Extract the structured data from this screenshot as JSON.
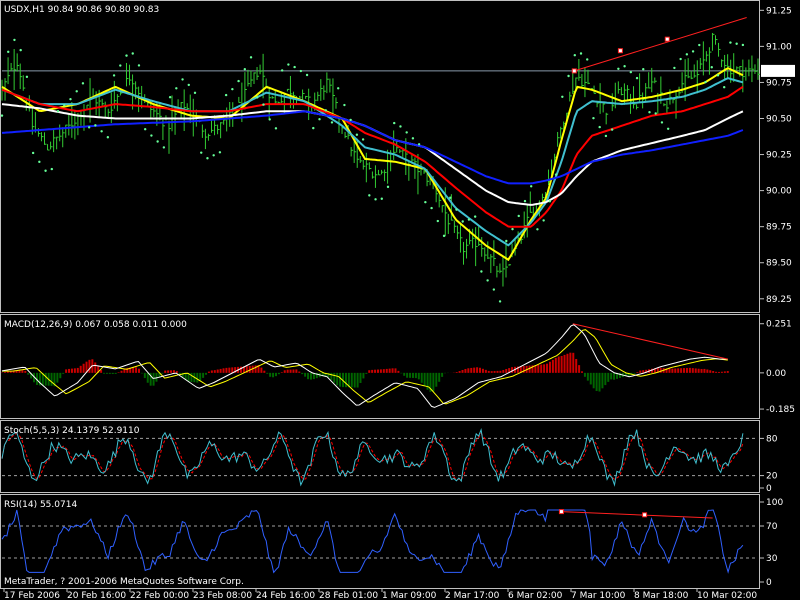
{
  "colors": {
    "background": "#000000",
    "frame": "#c0c0c0",
    "bars": "#33cc33",
    "psar": "#66ff99",
    "ma_yellow": "#ffff00",
    "ma_cyan": "#40c0d0",
    "ma_red": "#ff0000",
    "ma_white": "#ffffff",
    "ma_blue": "#1020ff",
    "trendline": "#ff2020",
    "macd_up": "#cc0000",
    "macd_down": "#006600",
    "macd_line": "#ffffff",
    "signal_line": "#ffff00",
    "stoch_main": "#40c0d0",
    "stoch_signal": "#ff0000",
    "rsi_line": "#3060ff",
    "level": "#a0a0a0"
  },
  "chart_data": [
    {
      "type": "candlestick",
      "title": "USDX,H1",
      "ohlc_text": "90.84 90.86 90.80 90.83",
      "current_price": "90.83",
      "ylim": [
        89.2,
        91.28
      ],
      "y_ticks": [
        "91.25",
        "91.00",
        "90.75",
        "90.50",
        "90.25",
        "90.00",
        "89.75",
        "89.50",
        "89.25"
      ],
      "y_tick_values": [
        91.25,
        91.0,
        90.75,
        90.5,
        90.25,
        90.0,
        89.75,
        89.5,
        89.25
      ],
      "x_labels": [
        "17 Feb 2006",
        "20 Feb 16:00",
        "22 Feb 00:00",
        "23 Feb 08:00",
        "24 Feb 16:00",
        "28 Feb 01:00",
        "1 Mar 09:00",
        "2 Mar 17:00",
        "6 Mar 02:00",
        "7 Mar 10:00",
        "8 Mar 18:00",
        "10 Mar 02:00"
      ],
      "price_path": [
        [
          0,
          90.7
        ],
        [
          0.02,
          90.9
        ],
        [
          0.04,
          90.45
        ],
        [
          0.06,
          90.3
        ],
        [
          0.09,
          90.45
        ],
        [
          0.12,
          90.65
        ],
        [
          0.14,
          90.55
        ],
        [
          0.17,
          90.8
        ],
        [
          0.19,
          90.6
        ],
        [
          0.22,
          90.45
        ],
        [
          0.24,
          90.6
        ],
        [
          0.27,
          90.4
        ],
        [
          0.29,
          90.45
        ],
        [
          0.31,
          90.55
        ],
        [
          0.34,
          90.85
        ],
        [
          0.36,
          90.6
        ],
        [
          0.38,
          90.7
        ],
        [
          0.41,
          90.6
        ],
        [
          0.43,
          90.75
        ],
        [
          0.45,
          90.45
        ],
        [
          0.47,
          90.2
        ],
        [
          0.5,
          90.1
        ],
        [
          0.52,
          90.3
        ],
        [
          0.55,
          90.15
        ],
        [
          0.57,
          90.05
        ],
        [
          0.59,
          89.8
        ],
        [
          0.61,
          89.6
        ],
        [
          0.63,
          89.65
        ],
        [
          0.65,
          89.5
        ],
        [
          0.66,
          89.4
        ],
        [
          0.68,
          89.6
        ],
        [
          0.7,
          89.85
        ],
        [
          0.72,
          90.0
        ],
        [
          0.74,
          90.45
        ],
        [
          0.76,
          90.8
        ],
        [
          0.78,
          90.7
        ],
        [
          0.8,
          90.55
        ],
        [
          0.82,
          90.7
        ],
        [
          0.84,
          90.6
        ],
        [
          0.86,
          90.75
        ],
        [
          0.88,
          90.6
        ],
        [
          0.9,
          90.75
        ],
        [
          0.92,
          90.8
        ],
        [
          0.94,
          91.05
        ],
        [
          0.96,
          90.85
        ],
        [
          0.98,
          90.83
        ]
      ],
      "series": [
        {
          "name": "",
          "style": "ma_yellow",
          "points": [
            [
              0,
              90.72
            ],
            [
              0.05,
              90.55
            ],
            [
              0.1,
              90.6
            ],
            [
              0.15,
              90.72
            ],
            [
              0.2,
              90.6
            ],
            [
              0.25,
              90.52
            ],
            [
              0.3,
              90.5
            ],
            [
              0.35,
              90.72
            ],
            [
              0.4,
              90.62
            ],
            [
              0.45,
              90.5
            ],
            [
              0.48,
              90.22
            ],
            [
              0.52,
              90.2
            ],
            [
              0.56,
              90.15
            ],
            [
              0.6,
              89.8
            ],
            [
              0.64,
              89.62
            ],
            [
              0.67,
              89.52
            ],
            [
              0.7,
              89.8
            ],
            [
              0.72,
              89.95
            ],
            [
              0.74,
              90.35
            ],
            [
              0.76,
              90.72
            ],
            [
              0.78,
              90.7
            ],
            [
              0.82,
              90.62
            ],
            [
              0.86,
              90.65
            ],
            [
              0.9,
              90.7
            ],
            [
              0.93,
              90.75
            ],
            [
              0.96,
              90.85
            ],
            [
              0.98,
              90.8
            ]
          ]
        },
        {
          "name": "",
          "style": "ma_cyan",
          "points": [
            [
              0,
              90.7
            ],
            [
              0.05,
              90.6
            ],
            [
              0.1,
              90.6
            ],
            [
              0.15,
              90.7
            ],
            [
              0.2,
              90.62
            ],
            [
              0.25,
              90.55
            ],
            [
              0.3,
              90.55
            ],
            [
              0.35,
              90.68
            ],
            [
              0.4,
              90.62
            ],
            [
              0.45,
              90.45
            ],
            [
              0.48,
              90.3
            ],
            [
              0.52,
              90.25
            ],
            [
              0.56,
              90.15
            ],
            [
              0.6,
              89.88
            ],
            [
              0.64,
              89.72
            ],
            [
              0.67,
              89.62
            ],
            [
              0.7,
              89.78
            ],
            [
              0.72,
              89.92
            ],
            [
              0.74,
              90.2
            ],
            [
              0.76,
              90.55
            ],
            [
              0.78,
              90.62
            ],
            [
              0.82,
              90.6
            ],
            [
              0.86,
              90.62
            ],
            [
              0.9,
              90.65
            ],
            [
              0.93,
              90.7
            ],
            [
              0.96,
              90.78
            ],
            [
              0.98,
              90.75
            ]
          ]
        },
        {
          "name": "",
          "style": "ma_red",
          "points": [
            [
              0,
              90.7
            ],
            [
              0.05,
              90.6
            ],
            [
              0.1,
              90.55
            ],
            [
              0.15,
              90.6
            ],
            [
              0.2,
              90.58
            ],
            [
              0.25,
              90.55
            ],
            [
              0.3,
              90.55
            ],
            [
              0.35,
              90.6
            ],
            [
              0.4,
              90.6
            ],
            [
              0.45,
              90.5
            ],
            [
              0.48,
              90.4
            ],
            [
              0.52,
              90.32
            ],
            [
              0.56,
              90.2
            ],
            [
              0.6,
              90.02
            ],
            [
              0.64,
              89.85
            ],
            [
              0.67,
              89.75
            ],
            [
              0.7,
              89.75
            ],
            [
              0.72,
              89.85
            ],
            [
              0.74,
              90.0
            ],
            [
              0.76,
              90.25
            ],
            [
              0.78,
              90.38
            ],
            [
              0.82,
              90.45
            ],
            [
              0.86,
              90.52
            ],
            [
              0.9,
              90.55
            ],
            [
              0.93,
              90.6
            ],
            [
              0.96,
              90.65
            ],
            [
              0.98,
              90.72
            ]
          ]
        },
        {
          "name": "",
          "style": "ma_white",
          "points": [
            [
              0,
              90.6
            ],
            [
              0.05,
              90.57
            ],
            [
              0.1,
              90.52
            ],
            [
              0.15,
              90.5
            ],
            [
              0.2,
              90.5
            ],
            [
              0.25,
              90.5
            ],
            [
              0.3,
              90.52
            ],
            [
              0.35,
              90.55
            ],
            [
              0.4,
              90.55
            ],
            [
              0.45,
              90.5
            ],
            [
              0.48,
              90.45
            ],
            [
              0.52,
              90.35
            ],
            [
              0.56,
              90.3
            ],
            [
              0.6,
              90.15
            ],
            [
              0.64,
              90.0
            ],
            [
              0.67,
              89.92
            ],
            [
              0.7,
              89.9
            ],
            [
              0.72,
              89.92
            ],
            [
              0.74,
              89.98
            ],
            [
              0.76,
              90.1
            ],
            [
              0.78,
              90.2
            ],
            [
              0.82,
              90.28
            ],
            [
              0.86,
              90.33
            ],
            [
              0.9,
              90.38
            ],
            [
              0.93,
              90.42
            ],
            [
              0.96,
              90.5
            ],
            [
              0.98,
              90.55
            ]
          ]
        },
        {
          "name": "",
          "style": "ma_blue",
          "points": [
            [
              0,
              90.4
            ],
            [
              0.05,
              90.42
            ],
            [
              0.1,
              90.44
            ],
            [
              0.15,
              90.46
            ],
            [
              0.2,
              90.47
            ],
            [
              0.25,
              90.48
            ],
            [
              0.3,
              90.5
            ],
            [
              0.35,
              90.52
            ],
            [
              0.4,
              90.55
            ],
            [
              0.45,
              90.5
            ],
            [
              0.48,
              90.45
            ],
            [
              0.52,
              90.35
            ],
            [
              0.56,
              90.3
            ],
            [
              0.6,
              90.2
            ],
            [
              0.64,
              90.1
            ],
            [
              0.67,
              90.05
            ],
            [
              0.7,
              90.05
            ],
            [
              0.72,
              90.07
            ],
            [
              0.74,
              90.1
            ],
            [
              0.76,
              90.15
            ],
            [
              0.78,
              90.2
            ],
            [
              0.82,
              90.25
            ],
            [
              0.86,
              90.28
            ],
            [
              0.9,
              90.32
            ],
            [
              0.93,
              90.35
            ],
            [
              0.96,
              90.38
            ],
            [
              0.98,
              90.42
            ]
          ]
        }
      ],
      "horizontal_line": 90.83,
      "trendline": [
        [
          0.757,
          90.83
        ],
        [
          0.985,
          91.2
        ]
      ],
      "trendline_markers": [
        [
          0.757,
          90.83
        ],
        [
          0.818,
          90.97
        ],
        [
          0.88,
          91.05
        ]
      ]
    },
    {
      "type": "histogram",
      "title": "MACD(12,26,9) 0.067 0.058 0.011 0.000",
      "ylim": [
        -0.2,
        0.27
      ],
      "y_ticks": [
        "0.251",
        "0.00",
        "-0.185"
      ],
      "y_tick_values": [
        0.251,
        0.0,
        -0.185
      ],
      "macd_path": [
        [
          0,
          0.01
        ],
        [
          0.03,
          0.03
        ],
        [
          0.05,
          -0.05
        ],
        [
          0.07,
          -0.12
        ],
        [
          0.1,
          -0.05
        ],
        [
          0.12,
          0.04
        ],
        [
          0.15,
          0.02
        ],
        [
          0.18,
          0.06
        ],
        [
          0.2,
          -0.03
        ],
        [
          0.23,
          0.0
        ],
        [
          0.26,
          -0.08
        ],
        [
          0.28,
          -0.05
        ],
        [
          0.31,
          0.01
        ],
        [
          0.34,
          0.07
        ],
        [
          0.36,
          0.03
        ],
        [
          0.39,
          0.05
        ],
        [
          0.41,
          0.0
        ],
        [
          0.43,
          -0.02
        ],
        [
          0.45,
          -0.1
        ],
        [
          0.47,
          -0.17
        ],
        [
          0.49,
          -0.12
        ],
        [
          0.52,
          -0.05
        ],
        [
          0.55,
          -0.08
        ],
        [
          0.57,
          -0.18
        ],
        [
          0.6,
          -0.13
        ],
        [
          0.63,
          -0.05
        ],
        [
          0.66,
          -0.02
        ],
        [
          0.68,
          0.02
        ],
        [
          0.7,
          0.06
        ],
        [
          0.72,
          0.1
        ],
        [
          0.74,
          0.18
        ],
        [
          0.755,
          0.251
        ],
        [
          0.77,
          0.2
        ],
        [
          0.79,
          0.05
        ],
        [
          0.81,
          0.0
        ],
        [
          0.83,
          -0.02
        ],
        [
          0.85,
          0.0
        ],
        [
          0.87,
          0.03
        ],
        [
          0.89,
          0.05
        ],
        [
          0.91,
          0.07
        ],
        [
          0.93,
          0.08
        ],
        [
          0.95,
          0.07
        ]
      ],
      "trendline": [
        [
          0.755,
          0.251
        ],
        [
          0.96,
          0.07
        ]
      ]
    },
    {
      "type": "line",
      "title": "Stoch(5,5,3) 24.1379 52.9110",
      "ylim": [
        0,
        100
      ],
      "y_ticks": [
        "80",
        "20",
        "0"
      ],
      "y_tick_values": [
        80,
        20,
        0
      ],
      "levels": [
        80,
        20
      ]
    },
    {
      "type": "line",
      "title": "RSI(14) 55.0714",
      "ylim": [
        0,
        100
      ],
      "y_ticks": [
        "100",
        "70",
        "30",
        "0"
      ],
      "y_tick_values": [
        100,
        70,
        30,
        0
      ],
      "levels": [
        70,
        30
      ],
      "trendline": [
        [
          0.74,
          88
        ],
        [
          0.94,
          80
        ]
      ],
      "trendline_markers": [
        [
          0.74,
          88
        ],
        [
          0.85,
          84
        ]
      ]
    }
  ],
  "copyright": "MetaTrader, ? 2001-2006 MetaQuotes Software Corp."
}
